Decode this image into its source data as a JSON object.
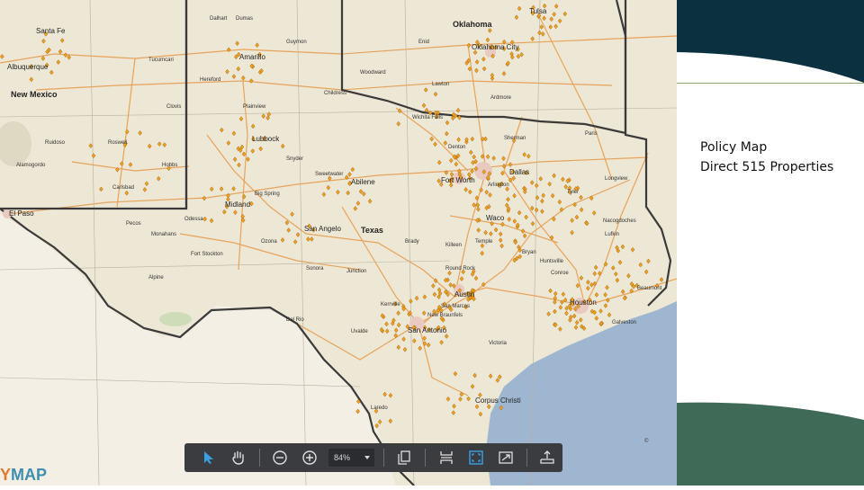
{
  "colors": {
    "land": "#ede7d5",
    "mexico": "#f3efe4",
    "water": "#9eb6cf",
    "road": "#e8a35a",
    "border": "#3a3a3a",
    "marker": "#f2a01c",
    "panel_dark": "#0b3040",
    "panel_green": "#3f6a58",
    "toolbar": "#3a3c40",
    "accent": "#3aa0e6"
  },
  "map": {
    "labels": {
      "santa_fe": "Santa Fe",
      "albuquerque": "Albuquerque",
      "new_mexico": "New Mexico",
      "ruidoso": "Ruidoso",
      "carlsbad": "Carlsbad",
      "alamogordo": "Alamogordo",
      "tucumcari": "Tucumcari",
      "clovis": "Clovis",
      "roswell": "Roswell",
      "hobbs": "Hobbs",
      "el_paso": "El Paso",
      "dalhart": "Dalhart",
      "dumas": "Dumas",
      "amarillo": "Amarillo",
      "hereford": "Hereford",
      "lubbock": "Lubbock",
      "plainview": "Plainview",
      "childress": "Childress",
      "guymon": "Guymon",
      "woodward": "Woodward",
      "enid": "Enid",
      "oklahoma": "Oklahoma",
      "oklahoma_city": "Oklahoma City",
      "tulsa": "Tulsa",
      "lawton": "Lawton",
      "ardmore": "Ardmore",
      "wichita_falls": "Wichita Falls",
      "denton": "Denton",
      "sherman": "Sherman",
      "paris": "Paris",
      "dallas": "Dallas",
      "fort_worth": "Fort Worth",
      "arlington": "Arlington",
      "tyler": "Tyler",
      "longview": "Longview",
      "abilene": "Abilene",
      "big_spring": "Big Spring",
      "midland": "Midland",
      "odessa": "Odessa",
      "san_angelo": "San Angelo",
      "texas": "Texas",
      "waco": "Waco",
      "killeen": "Killeen",
      "temple": "Temple",
      "bryan": "Bryan",
      "austin": "Austin",
      "round_rock": "Round Rock",
      "san_marcos": "San Marcos",
      "new_braunfels": "New Braunfels",
      "san_antonio": "San Antonio",
      "houston": "Houston",
      "beaumont": "Beaumont",
      "lufkin": "Lufkin",
      "nacogdoches": "Nacogdoches",
      "huntsville": "Huntsville",
      "victoria": "Victoria",
      "corpus_christi": "Corpus Christi",
      "laredo": "Laredo",
      "del_rio": "Del Rio",
      "uvalde": "Uvalde",
      "fort_stockton": "Fort Stockton",
      "alpine": "Alpine",
      "sonora": "Sonora",
      "junction": "Junction",
      "kerrville": "Kerrville",
      "brady": "Brady",
      "sweetwater": "Sweetwater",
      "snyder": "Snyder",
      "pecos": "Pecos",
      "monahans": "Monahans",
      "ozona": "Ozona",
      "galveston": "Galveston",
      "conroe": "Conroe"
    }
  },
  "toolbar": {
    "zoom_value": "84%",
    "tools": [
      {
        "name": "select-arrow-icon",
        "active": true
      },
      {
        "name": "pan-hand-icon",
        "active": false
      },
      {
        "name": "zoom-out-icon",
        "active": false
      },
      {
        "name": "zoom-in-icon",
        "active": false
      },
      {
        "name": "copy-icon",
        "active": false
      },
      {
        "name": "fit-width-icon",
        "active": false
      },
      {
        "name": "fit-page-icon",
        "active": true
      },
      {
        "name": "fullscreen-icon",
        "active": false
      },
      {
        "name": "export-icon",
        "active": false
      }
    ]
  },
  "logo": {
    "part1": "Y",
    "part2": "MAP"
  },
  "panel": {
    "title": "Policy Map",
    "subtitle": "Direct 515 Properties"
  }
}
